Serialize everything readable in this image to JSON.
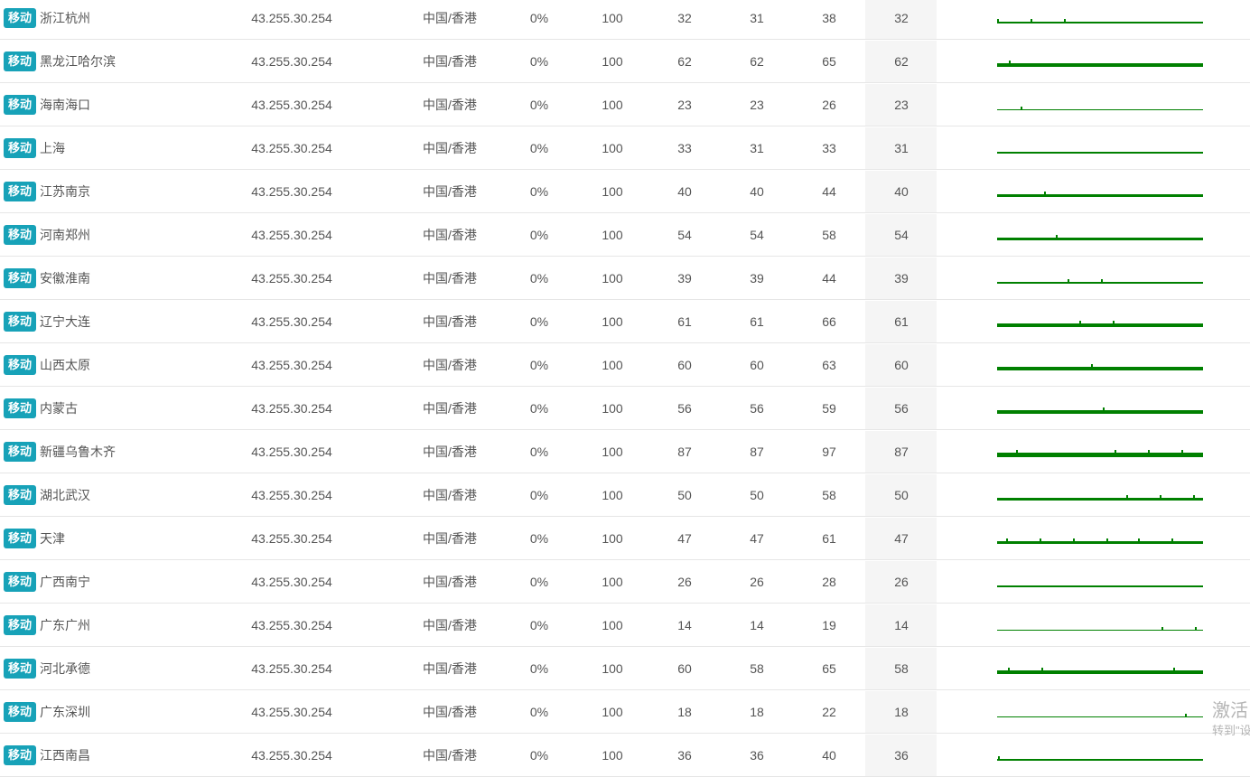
{
  "isp_label": "移动",
  "colors": {
    "badge": "#17a2b8",
    "spark": "#008000",
    "best_col_bg": "#f5f5f5"
  },
  "rows": [
    {
      "city": "浙江杭州",
      "ip": "43.255.30.254",
      "location": "中国/香港",
      "loss": "0%",
      "sent": "100",
      "last": "32",
      "avg": "31",
      "worst": "38",
      "best": "32"
    },
    {
      "city": "黑龙江哈尔滨",
      "ip": "43.255.30.254",
      "location": "中国/香港",
      "loss": "0%",
      "sent": "100",
      "last": "62",
      "avg": "62",
      "worst": "65",
      "best": "62"
    },
    {
      "city": "海南海口",
      "ip": "43.255.30.254",
      "location": "中国/香港",
      "loss": "0%",
      "sent": "100",
      "last": "23",
      "avg": "23",
      "worst": "26",
      "best": "23"
    },
    {
      "city": "上海",
      "ip": "43.255.30.254",
      "location": "中国/香港",
      "loss": "0%",
      "sent": "100",
      "last": "33",
      "avg": "31",
      "worst": "33",
      "best": "31"
    },
    {
      "city": "江苏南京",
      "ip": "43.255.30.254",
      "location": "中国/香港",
      "loss": "0%",
      "sent": "100",
      "last": "40",
      "avg": "40",
      "worst": "44",
      "best": "40"
    },
    {
      "city": "河南郑州",
      "ip": "43.255.30.254",
      "location": "中国/香港",
      "loss": "0%",
      "sent": "100",
      "last": "54",
      "avg": "54",
      "worst": "58",
      "best": "54"
    },
    {
      "city": "安徽淮南",
      "ip": "43.255.30.254",
      "location": "中国/香港",
      "loss": "0%",
      "sent": "100",
      "last": "39",
      "avg": "39",
      "worst": "44",
      "best": "39"
    },
    {
      "city": "辽宁大连",
      "ip": "43.255.30.254",
      "location": "中国/香港",
      "loss": "0%",
      "sent": "100",
      "last": "61",
      "avg": "61",
      "worst": "66",
      "best": "61"
    },
    {
      "city": "山西太原",
      "ip": "43.255.30.254",
      "location": "中国/香港",
      "loss": "0%",
      "sent": "100",
      "last": "60",
      "avg": "60",
      "worst": "63",
      "best": "60"
    },
    {
      "city": "内蒙古",
      "ip": "43.255.30.254",
      "location": "中国/香港",
      "loss": "0%",
      "sent": "100",
      "last": "56",
      "avg": "56",
      "worst": "59",
      "best": "56"
    },
    {
      "city": "新疆乌鲁木齐",
      "ip": "43.255.30.254",
      "location": "中国/香港",
      "loss": "0%",
      "sent": "100",
      "last": "87",
      "avg": "87",
      "worst": "97",
      "best": "87"
    },
    {
      "city": "湖北武汉",
      "ip": "43.255.30.254",
      "location": "中国/香港",
      "loss": "0%",
      "sent": "100",
      "last": "50",
      "avg": "50",
      "worst": "58",
      "best": "50"
    },
    {
      "city": "天津",
      "ip": "43.255.30.254",
      "location": "中国/香港",
      "loss": "0%",
      "sent": "100",
      "last": "47",
      "avg": "47",
      "worst": "61",
      "best": "47"
    },
    {
      "city": "广西南宁",
      "ip": "43.255.30.254",
      "location": "中国/香港",
      "loss": "0%",
      "sent": "100",
      "last": "26",
      "avg": "26",
      "worst": "28",
      "best": "26"
    },
    {
      "city": "广东广州",
      "ip": "43.255.30.254",
      "location": "中国/香港",
      "loss": "0%",
      "sent": "100",
      "last": "14",
      "avg": "14",
      "worst": "19",
      "best": "14"
    },
    {
      "city": "河北承德",
      "ip": "43.255.30.254",
      "location": "中国/香港",
      "loss": "0%",
      "sent": "100",
      "last": "60",
      "avg": "58",
      "worst": "65",
      "best": "58"
    },
    {
      "city": "广东深圳",
      "ip": "43.255.30.254",
      "location": "中国/香港",
      "loss": "0%",
      "sent": "100",
      "last": "18",
      "avg": "18",
      "worst": "22",
      "best": "18"
    },
    {
      "city": "江西南昌",
      "ip": "43.255.30.254",
      "location": "中国/香港",
      "loss": "0%",
      "sent": "100",
      "last": "36",
      "avg": "36",
      "worst": "40",
      "best": "36"
    }
  ],
  "watermark": {
    "line1": "激活",
    "line2": "转到\"设"
  }
}
